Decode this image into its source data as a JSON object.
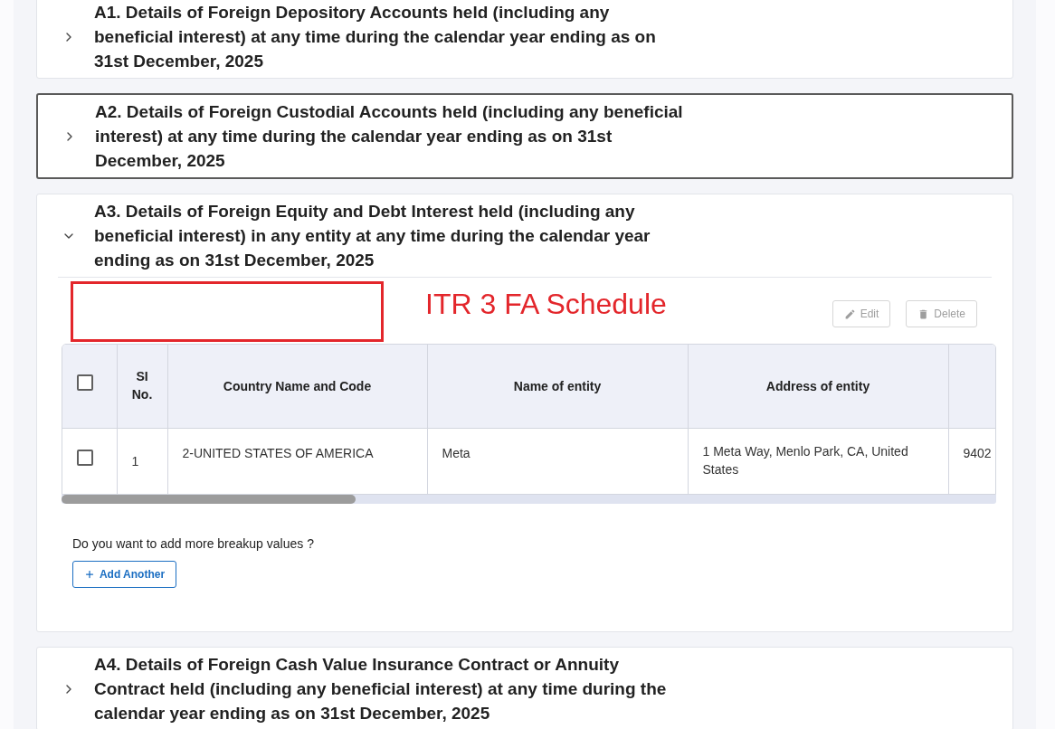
{
  "sections": [
    {
      "title": "A1. Details of Foreign Depository Accounts held (including any beneficial interest) at any time during the calendar year ending as on 31st December, 2025",
      "expanded": false,
      "focused": false
    },
    {
      "title": "A2. Details of Foreign Custodial Accounts held (including any beneficial interest) at any time during the calendar year ending as on 31st December, 2025",
      "expanded": false,
      "focused": true
    },
    {
      "title": "A3. Details of Foreign Equity and Debt Interest held (including any beneficial interest) in any entity at any time during the calendar year ending as on 31st December, 2025",
      "expanded": true,
      "focused": false,
      "content": {
        "annotation": {
          "text": "ITR 3 FA Schedule"
        },
        "toolbar": [
          {
            "kind": "edit",
            "label": "Edit",
            "disabled": true
          },
          {
            "kind": "delete",
            "label": "Delete",
            "disabled": true
          }
        ],
        "table": {
          "select_all": {
            "checked": false
          },
          "columns": [
            "SI No.",
            "Country Name and Code",
            "Name of entity",
            "Address of entity"
          ],
          "rows": [
            {
              "checked": false,
              "cells": [
                "1",
                "2-UNITED STATES OF AMERICA",
                "Meta",
                "1 Meta Way, Menlo Park, CA, United States",
                "9402"
              ]
            }
          ]
        },
        "prompt": "Do you want to add more breakup values ?",
        "add_button": {
          "label": "Add Another"
        }
      }
    },
    {
      "title": "A4. Details of Foreign Cash Value Insurance Contract or Annuity Contract held (including any beneficial interest) at any time during the calendar year ending as on 31st December, 2025",
      "expanded": false,
      "focused": false
    }
  ]
}
